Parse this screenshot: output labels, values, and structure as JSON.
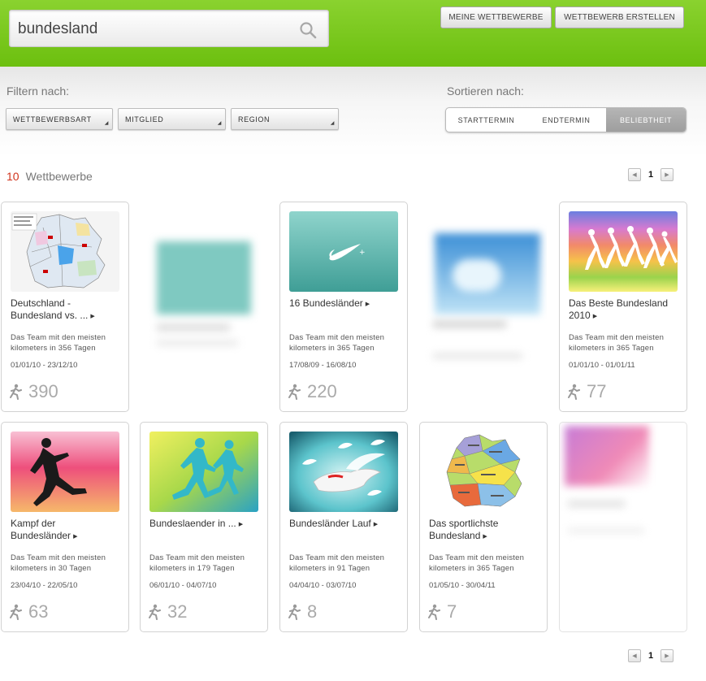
{
  "search": {
    "value": "bundesland"
  },
  "header": {
    "my_competitions": "MEINE WETTBEWERBE",
    "create_competition": "WETTBEWERB ERSTELLEN"
  },
  "filter": {
    "label": "Filtern nach:",
    "dropdowns": [
      "WETTBEWERBSART",
      "MITGLIED",
      "REGION"
    ]
  },
  "sort": {
    "label": "Sortieren nach:",
    "options": [
      "STARTTERMIN",
      "ENDTERMIN",
      "BELIEBTHEIT"
    ],
    "active": "BELIEBTHEIT"
  },
  "results": {
    "count": "10",
    "label": "Wettbewerbe"
  },
  "pagination": {
    "current": "1"
  },
  "cards": [
    {
      "title": "Deutschland - Bundesland vs. ...",
      "desc": "Das Team mit den meisten kilometers in 356 Tagen",
      "dates": "01/01/10 - 23/12/10",
      "count": "390",
      "image": "germany-map-states"
    },
    {
      "title": "",
      "desc": "",
      "dates": "",
      "count": "",
      "image": "blurred-teal"
    },
    {
      "title": "16 Bundesländer",
      "desc": "Das Team mit den meisten kilometers in 365 Tagen",
      "dates": "17/08/09 - 16/08/10",
      "count": "220",
      "image": "nike-swoosh-teal"
    },
    {
      "title": "",
      "desc": "",
      "dates": "",
      "count": "",
      "image": "blurred-blue-sky"
    },
    {
      "title": "Das Beste Bundesland 2010",
      "desc": "Das Team mit den meisten kilometers in 365 Tagen",
      "dates": "01/01/10 - 01/01/11",
      "count": "77",
      "image": "runners-rainbow"
    },
    {
      "title": "Kampf der Bundesländer",
      "desc": "Das Team mit den meisten kilometers in 30 Tagen",
      "dates": "23/04/10 - 22/05/10",
      "count": "63",
      "image": "sprinter-silhouette-pink"
    },
    {
      "title": "Bundeslaender in ...",
      "desc": "Das Team mit den meisten kilometers in 179 Tagen",
      "dates": "06/01/10 - 04/07/10",
      "count": "32",
      "image": "two-runners-green"
    },
    {
      "title": "Bundesländer Lauf",
      "desc": "Das Team mit den meisten kilometers in 91 Tagen",
      "dates": "04/04/10 - 03/07/10",
      "count": "8",
      "image": "winged-shoes"
    },
    {
      "title": "Das sportlichste Bundesland",
      "desc": "Das Team mit den meisten kilometers in 365 Tagen",
      "dates": "01/05/10 - 30/04/11",
      "count": "7",
      "image": "germany-map-colored"
    },
    {
      "title": "",
      "desc": "",
      "dates": "",
      "count": "",
      "image": "blurred-pink"
    }
  ],
  "colors": {
    "header_green": "#7ac81d",
    "accent_red": "#d0331c",
    "active_sort": "#a8a8a8"
  }
}
